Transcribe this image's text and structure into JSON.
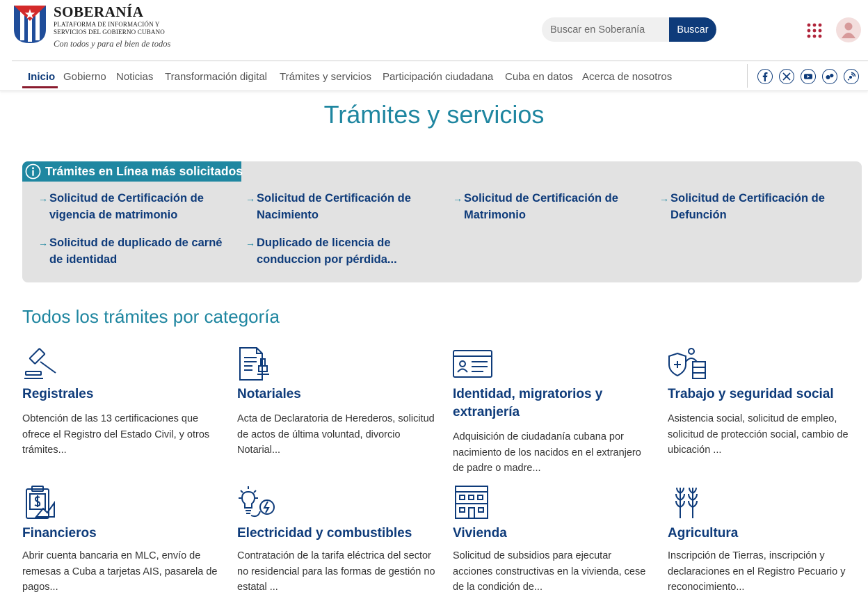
{
  "brand": {
    "title": "SOBERANÍA",
    "subtitle": "Plataforma de información y servicios del Gobierno Cubano",
    "tagline": "Con todos y para el bien de todos"
  },
  "search": {
    "placeholder": "Buscar en Soberanía",
    "button_label": "Buscar"
  },
  "icons": {
    "apps": "apps-grid-icon",
    "user": "user-avatar-icon"
  },
  "nav": {
    "items": [
      {
        "label": "Inicio"
      },
      {
        "label": "Gobierno"
      },
      {
        "label": "Noticias"
      },
      {
        "label": "Transformación digital"
      },
      {
        "label": "Trámites y servicios"
      },
      {
        "label": "Participación ciudadana"
      },
      {
        "label": "Cuba en datos"
      },
      {
        "label": "Acerca de nosotros"
      }
    ],
    "active": "Inicio",
    "social": [
      "facebook-icon",
      "x-twitter-icon",
      "youtube-icon",
      "flickr-icon",
      "podcast-icon"
    ]
  },
  "page": {
    "title": "Trámites y servicios"
  },
  "quick": {
    "heading": "Trámites en Línea más solicitados",
    "links": [
      {
        "label": "Solicitud de Certificación de vigencia de matrimonio"
      },
      {
        "label": "Solicitud de Certificación de Nacimiento"
      },
      {
        "label": "Solicitud de Certificación de Matrimonio"
      },
      {
        "label": "Solicitud de Certificación de Defunción"
      },
      {
        "label": " Solicitud de duplicado de carné de identidad"
      },
      {
        "label": "Duplicado de licencia de conduccion por pérdida..."
      }
    ]
  },
  "categories": {
    "heading": "Todos los trámites por categoría",
    "items": [
      {
        "title": "Registrales",
        "desc": "Obtención de las 13 certificaciones que ofrece el Registro del Estado Civil, y otros trámites...",
        "icon": "gavel-icon"
      },
      {
        "title": "Notariales",
        "desc": "Acta de Declaratoria de Herederos, solicitud de actos de última voluntad, divorcio Notarial...",
        "icon": "notary-document-icon"
      },
      {
        "title": "Identidad, migratorios y extranjería",
        "desc": "Adquisición de ciudadanía cubana por nacimiento de los nacidos en el extranjero de padre o madre...",
        "icon": "id-card-icon"
      },
      {
        "title": "Trabajo y seguridad social",
        "desc": "Asistencia social, solicitud de empleo, solicitud de protección social, cambio de ubicación ...",
        "icon": "worker-shield-icon"
      },
      {
        "title": "Financieros",
        "desc": "Abrir cuenta bancaria en MLC, envío de remesas a Cuba a tarjetas AIS, pasarela de pagos...",
        "icon": "finance-clipboard-icon"
      },
      {
        "title": "Electricidad y combustibles",
        "desc": "Contratación de la tarifa eléctrica del sector no residencial para las formas de gestión no estatal ...",
        "icon": "lightbulb-energy-icon"
      },
      {
        "title": "Vivienda",
        "desc": "Solicitud de subsidios para ejecutar acciones constructivas en la vivienda, cese de la condición de...",
        "icon": "building-icon"
      },
      {
        "title": "Agricultura",
        "desc": "Inscripción de Tierras, inscripción y declaraciones en el Registro Pecuario y reconocimiento...",
        "icon": "wheat-icon"
      }
    ]
  },
  "colors": {
    "primary_navy": "#0e3b7a",
    "teal": "#1f86a0",
    "accent_red": "#8a1c2e",
    "panel_gray": "#e2e2e2"
  }
}
